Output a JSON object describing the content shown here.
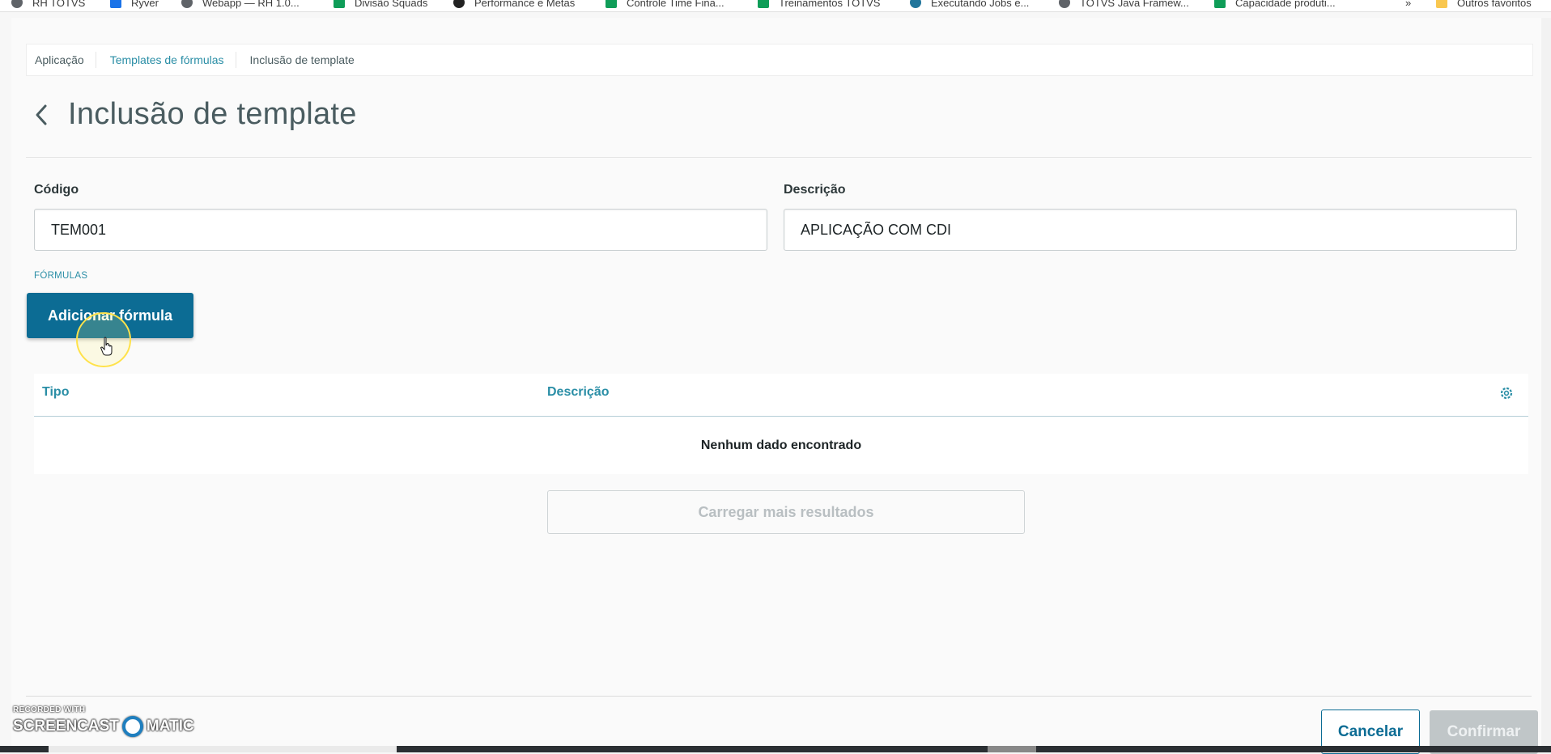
{
  "bookmarks": [
    {
      "label": "RH TOTVS",
      "icon": "chrome-icon"
    },
    {
      "label": "Ryver",
      "icon": "ryver-icon"
    },
    {
      "label": "Webapp — RH 1.0...",
      "icon": "chrome-icon"
    },
    {
      "label": "Divisão Squads",
      "icon": "sheets-icon"
    },
    {
      "label": "Performance e Metas",
      "icon": "github-icon"
    },
    {
      "label": "Controle Time Fina...",
      "icon": "sheets-icon"
    },
    {
      "label": "Treinamentos TOTVS",
      "icon": "sheets-icon"
    },
    {
      "label": "Executando Jobs e...",
      "icon": "wordpress-icon"
    },
    {
      "label": "TOTVS Java Framew...",
      "icon": "chrome-icon"
    },
    {
      "label": "Capacidade produti...",
      "icon": "sheets-icon"
    },
    {
      "label": "»",
      "icon": ""
    },
    {
      "label": "Outros favoritos",
      "icon": "folder-icon"
    }
  ],
  "breadcrumb": {
    "items": [
      "Aplicação",
      "Templates de fórmulas",
      "Inclusão de template"
    ]
  },
  "page": {
    "title": "Inclusão de template"
  },
  "form": {
    "codigo_label": "Código",
    "codigo_value": "TEM001",
    "descricao_label": "Descrição",
    "descricao_value": "APLICAÇÃO COM CDI",
    "section_label": "FÓRMULAS"
  },
  "actions": {
    "add_formula": "Adicionar fórmula",
    "load_more": "Carregar mais resultados",
    "cancel": "Cancelar",
    "confirm": "Confirmar"
  },
  "table": {
    "columns": [
      "Tipo",
      "Descrição"
    ],
    "empty_message": "Nenhum dado encontrado"
  },
  "watermark": {
    "top": "RECORDED WITH",
    "left": "SCREENCAST",
    "right": "MATIC"
  },
  "colors": {
    "primary": "#0c6c94",
    "link": "#2a8ea6",
    "disabled": "#c0c6c8"
  }
}
